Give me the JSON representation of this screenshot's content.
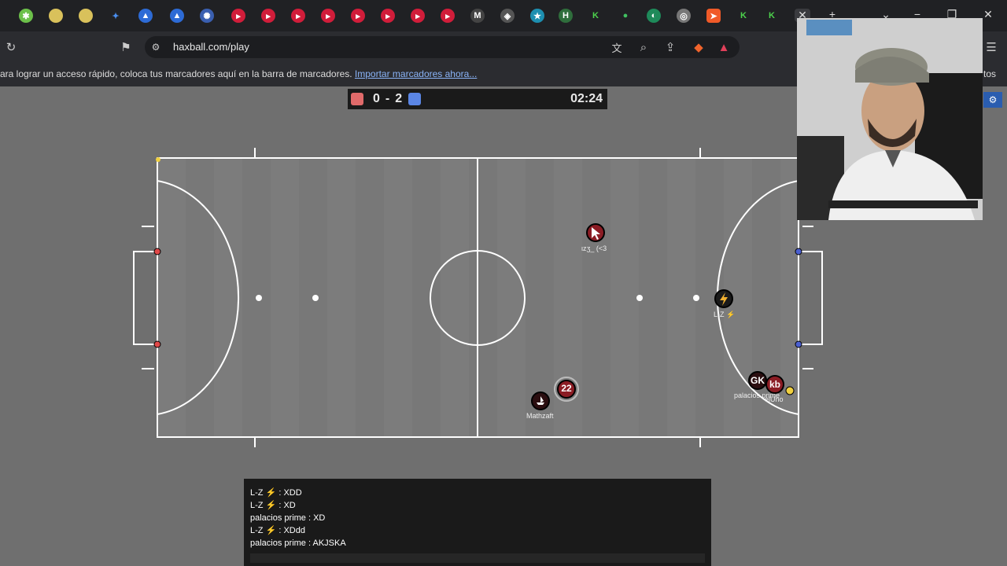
{
  "browser": {
    "url": "haxball.com/play",
    "bookmarks_bar_text": "ara lograr un acceso rápido, coloca tus marcadores aquí en la barra de marcadores.",
    "bookmarks_import_link": "Importar marcadores ahora...",
    "bookmarks_right_text": "tos"
  },
  "score": {
    "red_score": "0",
    "separator": "-",
    "blue_score": "2",
    "time": "02:24",
    "red_color": "#e06a6a",
    "blue_color": "#5b86e5"
  },
  "players": [
    {
      "id": "p1",
      "number": "",
      "name": "ιzʒ_ (<3",
      "team": "red",
      "icon": "cursor-icon"
    },
    {
      "id": "p2",
      "number": "",
      "name": "L-Z ⚡",
      "team": "red",
      "icon": "lightning-icon"
    },
    {
      "id": "p3",
      "number": "22",
      "name": "",
      "team": "red",
      "icon": ""
    },
    {
      "id": "p4",
      "number": "",
      "name": "Mathzaft",
      "team": "red",
      "icon": "boat-icon"
    },
    {
      "id": "p5",
      "number": "GK",
      "name": "palacios prime",
      "team": "red",
      "icon": ""
    },
    {
      "id": "p6",
      "number": "kb",
      "name": "elUno",
      "team": "red",
      "icon": ""
    }
  ],
  "chat": {
    "lines": [
      {
        "author": "L-Z ⚡",
        "message": "XDD"
      },
      {
        "author": "L-Z ⚡",
        "message": "XD"
      },
      {
        "author": "palacios prime",
        "message": "XD"
      },
      {
        "author": "L-Z ⚡",
        "message": "XDdd"
      },
      {
        "author": "palacios prime",
        "message": "AKJSKA"
      }
    ]
  },
  "colors": {
    "pitch": "#7a7a7a",
    "field_lines": "#ffffff",
    "red_post": "#e04848",
    "blue_post": "#4a5fd0",
    "team_red_disc": "#8b1c24",
    "ball": "#ffffff"
  }
}
